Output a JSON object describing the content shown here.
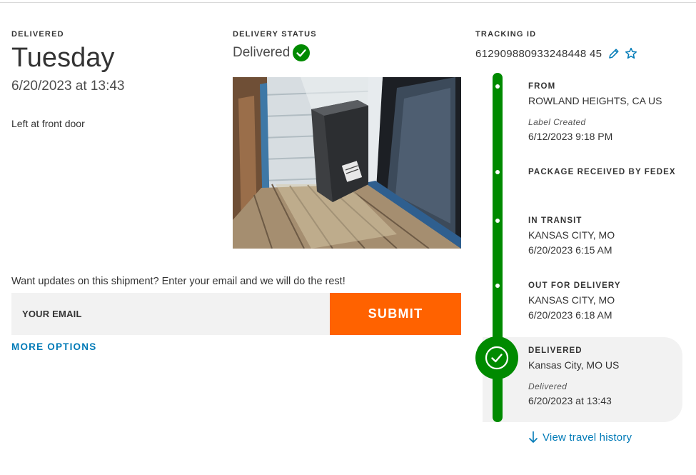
{
  "delivered_section": {
    "label": "DELIVERED",
    "day": "Tuesday",
    "datetime": "6/20/2023 at 13:43",
    "note": "Left at front door"
  },
  "status_section": {
    "label": "DELIVERY STATUS",
    "status": "Delivered"
  },
  "email_updates": {
    "prompt": "Want updates on this shipment? Enter your email and we will do the rest!",
    "placeholder": "YOUR EMAIL",
    "value": "",
    "submit_label": "SUBMIT",
    "more_options_label": "MORE OPTIONS"
  },
  "tracking": {
    "label": "TRACKING ID",
    "number": "612909880933248448 45"
  },
  "timeline": {
    "from": {
      "heading": "FROM",
      "location": "ROWLAND HEIGHTS, CA US",
      "event": "Label Created",
      "time": "6/12/2023 9:18 PM"
    },
    "received": {
      "heading": "PACKAGE RECEIVED BY FEDEX"
    },
    "in_transit": {
      "heading": "IN TRANSIT",
      "location": "KANSAS CITY, MO",
      "time": "6/20/2023 6:15 AM"
    },
    "out_for_delivery": {
      "heading": "OUT FOR DELIVERY",
      "location": "KANSAS CITY, MO",
      "time": "6/20/2023 6:18 AM"
    },
    "delivered": {
      "heading": "DELIVERED",
      "location": "Kansas City, MO US",
      "event": "Delivered",
      "time": "6/20/2023 at 13:43"
    }
  },
  "travel_history_label": "View travel history",
  "colors": {
    "success_green": "#008a00",
    "submit_orange": "#ff6200",
    "link_blue": "#007ab7",
    "input_bg": "#f2f2f2"
  },
  "icons": {
    "status": "check-circle-icon",
    "edit": "pencil-icon",
    "favorite": "star-outline-icon",
    "delivered": "check-circle-large-icon",
    "history": "arrow-down-icon"
  }
}
